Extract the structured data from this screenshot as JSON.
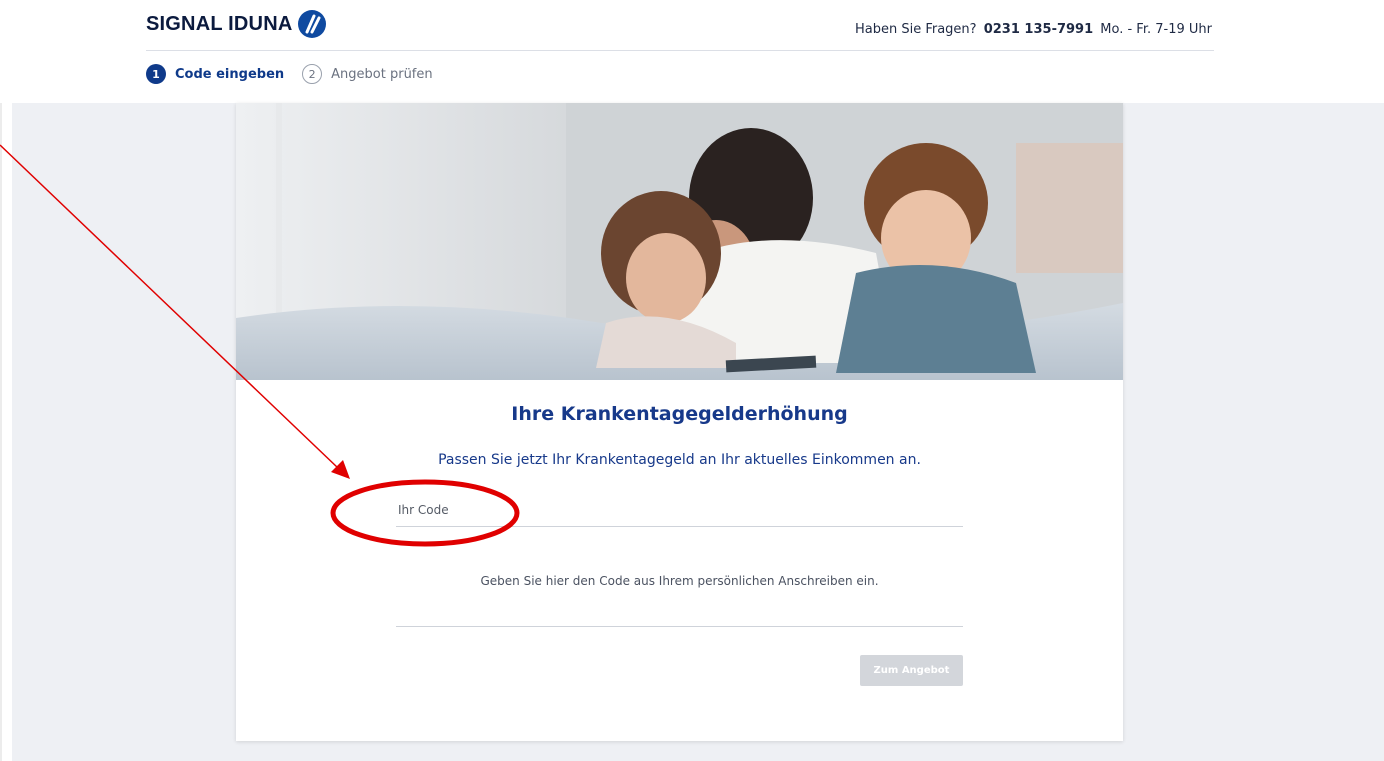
{
  "header": {
    "logo_text": "SIGNAL IDUNA",
    "contact_prefix": "Haben Sie Fragen?",
    "contact_phone": "0231 135-7991",
    "contact_hours": "Mo. - Fr. 7-19 Uhr"
  },
  "steps": [
    {
      "number": "1",
      "label": "Code eingeben",
      "state": "active"
    },
    {
      "number": "2",
      "label": "Angebot prüfen",
      "state": "inactive"
    }
  ],
  "card": {
    "title": "Ihre Krankentagegelderhöhung",
    "subtitle": "Passen Sie jetzt Ihr Krankentagegeld an Ihr aktuelles Einkommen an.",
    "code_label": "Ihr Code",
    "code_value": "",
    "hint": "Geben Sie hier den Code aus Ihrem persönlichen Anschreiben ein.",
    "submit_label": "Zum Angebot"
  },
  "colors": {
    "brand_blue": "#17398a",
    "step_active": "#0f3a8a",
    "annotation_red": "#e00000",
    "button_disabled": "#d3d6db"
  }
}
